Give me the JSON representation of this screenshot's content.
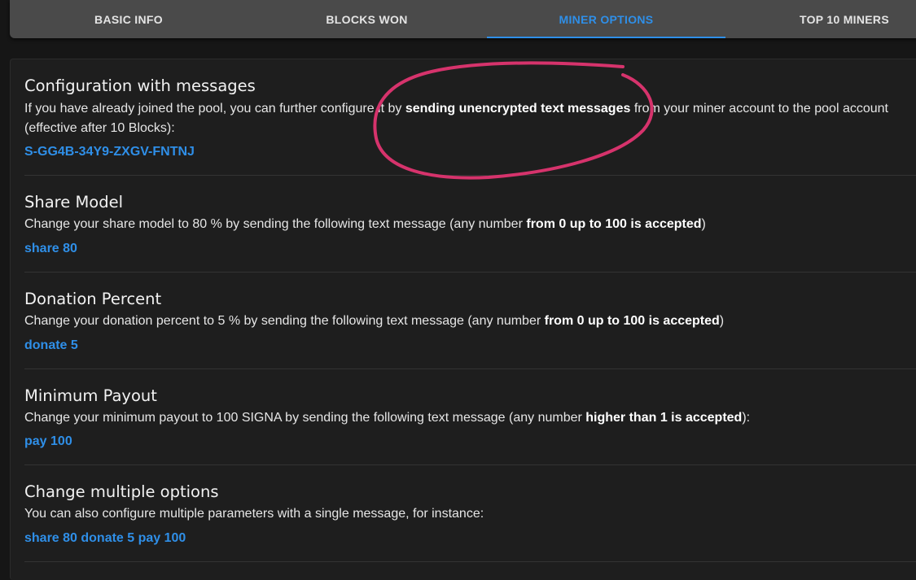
{
  "tabs": [
    {
      "label": "BASIC INFO",
      "active": false
    },
    {
      "label": "BLOCKS WON",
      "active": false
    },
    {
      "label": "MINER OPTIONS",
      "active": true
    },
    {
      "label": "TOP 10 MINERS",
      "active": false
    }
  ],
  "colors": {
    "accent": "#2f8fe8",
    "annotation": "#d6336c",
    "background": "#161616",
    "card": "#1e1e1e",
    "tabbar": "#4a4a4a"
  },
  "sections": [
    {
      "title": "Configuration with messages",
      "desc_pre": "If you have already joined the pool, you can further configure it by ",
      "desc_bold": "sending unencrypted text messages",
      "desc_post": " from your miner account to the pool account (effective after 10 Blocks):",
      "command": "S-GG4B-34Y9-ZXGV-FNTNJ"
    },
    {
      "title": "Share Model",
      "desc_pre": "Change your share model to 80 % by sending the following text message (any number ",
      "desc_bold": "from 0 up to 100 is accepted",
      "desc_post": ")",
      "command": "share 80"
    },
    {
      "title": "Donation Percent",
      "desc_pre": "Change your donation percent to 5 % by sending the following text message (any number ",
      "desc_bold": "from 0 up to 100 is accepted",
      "desc_post": ")",
      "command": "donate 5"
    },
    {
      "title": "Minimum Payout",
      "desc_pre": "Change your minimum payout to 100 SIGNA by sending the following text message (any number ",
      "desc_bold": "higher than 1 is accepted",
      "desc_post": "):",
      "command": "pay 100"
    },
    {
      "title": "Change multiple options",
      "desc_pre": "You can also configure multiple parameters with a single message, for instance:",
      "desc_bold": "",
      "desc_post": "",
      "command": "share 80 donate 5 pay 100"
    }
  ]
}
